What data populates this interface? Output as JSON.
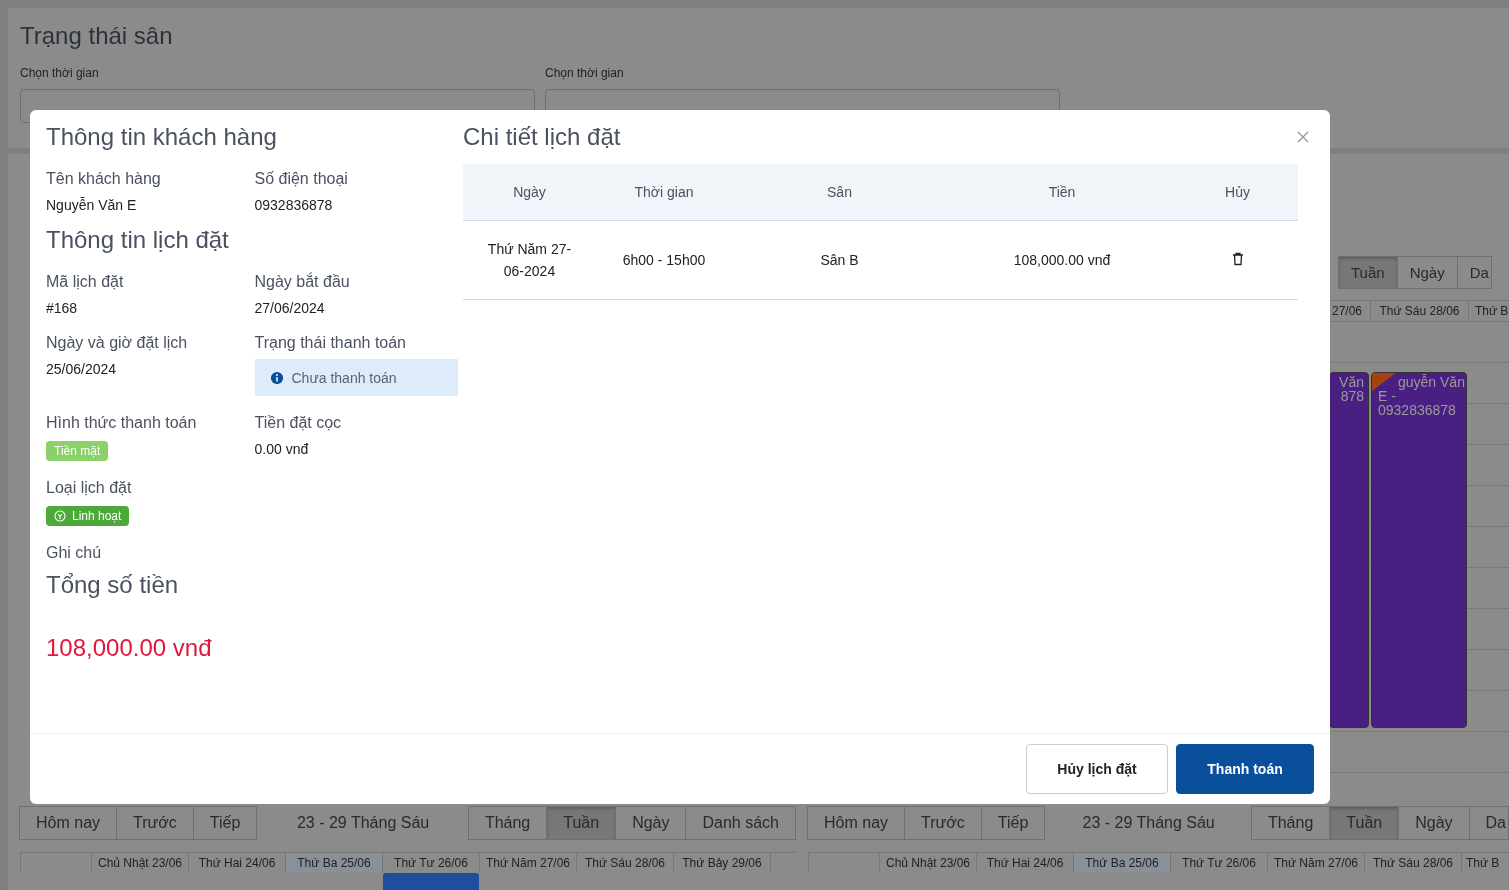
{
  "page": {
    "title": "Trạng thái sân",
    "filters": [
      {
        "label": "Chọn thời gian"
      },
      {
        "label": "Chọn thời gian"
      }
    ]
  },
  "schedule_strip": {
    "views": [
      {
        "label": "Tuần",
        "selected": true
      },
      {
        "label": "Ngày",
        "selected": false
      },
      {
        "label": "Da",
        "selected": false
      }
    ],
    "day_headers": [
      "27/06",
      "Thứ Sáu 28/06",
      "Thứ B"
    ],
    "events": [
      {
        "lines": [
          "Văn",
          "878"
        ],
        "unpaid_ribbon": false
      },
      {
        "lines": [
          "guyễn Văn",
          "E -",
          "0932836878"
        ],
        "unpaid_ribbon": true
      }
    ]
  },
  "calendars": [
    {
      "nav": [
        "Hôm nay",
        "Trước",
        "Tiếp"
      ],
      "title": "23 - 29 Tháng Sáu",
      "views": [
        {
          "label": "Tháng",
          "selected": false
        },
        {
          "label": "Tuần",
          "selected": true
        },
        {
          "label": "Ngày",
          "selected": false
        },
        {
          "label": "Danh sách",
          "selected": false
        }
      ],
      "day_headers": [
        {
          "label": "Chủ Nhật 23/06",
          "today": false
        },
        {
          "label": "Thứ Hai 24/06",
          "today": false
        },
        {
          "label": "Thứ Ba 25/06",
          "today": true
        },
        {
          "label": "Thứ Tư 26/06",
          "today": false,
          "event": true
        },
        {
          "label": "Thứ Năm 27/06",
          "today": false
        },
        {
          "label": "Thứ Sáu 28/06",
          "today": false
        },
        {
          "label": "Thứ Bảy 29/06",
          "today": false
        }
      ]
    },
    {
      "nav": [
        "Hôm nay",
        "Trước",
        "Tiếp"
      ],
      "title": "23 - 29 Tháng Sáu",
      "views": [
        {
          "label": "Tháng",
          "selected": false
        },
        {
          "label": "Tuần",
          "selected": true
        },
        {
          "label": "Ngày",
          "selected": false
        },
        {
          "label": "Da",
          "selected": false
        }
      ],
      "day_headers": [
        {
          "label": "Chủ Nhật 23/06",
          "today": false
        },
        {
          "label": "Thứ Hai 24/06",
          "today": false
        },
        {
          "label": "Thứ Ba 25/06",
          "today": true
        },
        {
          "label": "Thứ Tư 26/06",
          "today": false
        },
        {
          "label": "Thứ Năm 27/06",
          "today": false
        },
        {
          "label": "Thứ Sáu 28/06",
          "today": false
        },
        {
          "label": "Thứ B",
          "today": false
        }
      ]
    }
  ],
  "modal": {
    "customer": {
      "title": "Thông tin khách hàng",
      "fields": [
        {
          "label": "Tên khách hàng",
          "value": "Nguyễn Văn E"
        },
        {
          "label": "Số điện thoại",
          "value": "0932836878"
        }
      ]
    },
    "booking": {
      "title": "Thông tin lịch đặt",
      "rows": [
        [
          {
            "kind": "text",
            "label": "Mã lịch đặt",
            "value": "#168"
          },
          {
            "kind": "text",
            "label": "Ngày bắt đầu",
            "value": "27/06/2024"
          }
        ],
        [
          {
            "kind": "text",
            "label": "Ngày và giờ đặt lịch",
            "value": "25/06/2024"
          },
          {
            "kind": "status",
            "label": "Trạng thái thanh toán",
            "value": "Chưa thanh toán",
            "paid": false
          }
        ],
        [
          {
            "kind": "badge",
            "label": "Hình thức thanh toán",
            "value": "Tiền mặt",
            "color": "#8bd16a",
            "icon": false
          },
          {
            "kind": "text",
            "label": "Tiền đặt cọc",
            "value": "0.00 vnđ"
          }
        ],
        [
          {
            "kind": "badge",
            "label": "Loại lịch đặt",
            "value": "Linh hoạt",
            "color": "#4caa38",
            "icon": true
          }
        ],
        [
          {
            "kind": "note",
            "label": "Ghi chú"
          }
        ]
      ]
    },
    "total": {
      "title": "Tổng số tiền",
      "amount": "108,000.00 vnđ"
    },
    "details": {
      "title": "Chi tiết lịch đặt",
      "columns": [
        "Ngày",
        "Thời gian",
        "Sân",
        "Tiền",
        "Hủy"
      ],
      "rows": [
        {
          "date": "Thứ Năm 27-06-2024",
          "time": "6h00 - 15h00",
          "court": "Sân B",
          "price": "108,000.00 vnđ"
        }
      ]
    },
    "buttons": [
      {
        "label": "Hủy lịch đặt",
        "kind": "secondary"
      },
      {
        "label": "Thanh toán",
        "kind": "primary"
      }
    ]
  }
}
